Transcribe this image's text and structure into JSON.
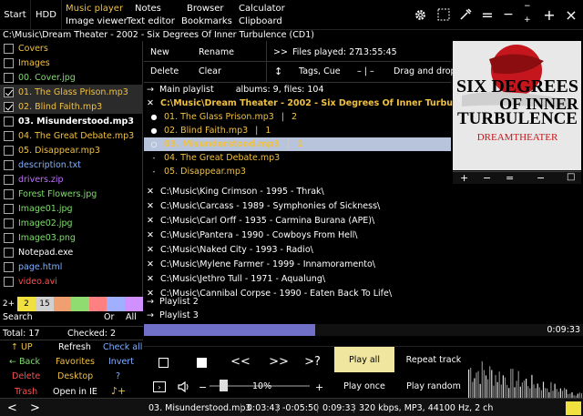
{
  "top": {
    "start": "Start",
    "hdd": "HDD",
    "menu_row1": [
      "Music player",
      "Notes",
      "Browser",
      "Calculator"
    ],
    "menu_row2": [
      "Image viewer",
      "Text editor",
      "Bookmarks",
      "Clipboard"
    ],
    "icons": [
      "gear-icon",
      "select-icon",
      "eyedropper-icon",
      "menu-icon",
      "minimize-icon",
      "maximize-icon",
      "close-icon"
    ],
    "win_plus": "+",
    "win_close": "×",
    "win_eq": "=",
    "win_min": "−",
    "win_dash_small": "−",
    "win_plus_small": "+"
  },
  "path": "C:\\Music\\Dream Theater - 2002 - Six Degrees Of Inner Turbulence (CD1)",
  "files": [
    {
      "name": "Covers",
      "color": "#f0c040",
      "checked": false,
      "bold": false,
      "sel": false
    },
    {
      "name": "Images",
      "color": "#f0c040",
      "checked": false,
      "bold": false,
      "sel": false
    },
    {
      "name": "00. Cover.jpg",
      "color": "#7fdc6c",
      "checked": false,
      "bold": false,
      "sel": false
    },
    {
      "name": "01. The Glass Prison.mp3",
      "color": "#f0c040",
      "checked": true,
      "bold": false,
      "sel": true
    },
    {
      "name": "02. Blind Faith.mp3",
      "color": "#f0c040",
      "checked": true,
      "bold": false,
      "sel": true
    },
    {
      "name": "03. Misunderstood.mp3",
      "color": "#ffffff",
      "checked": false,
      "bold": true,
      "sel": false
    },
    {
      "name": "04. The Great Debate.mp3",
      "color": "#f0c040",
      "checked": false,
      "bold": false,
      "sel": false
    },
    {
      "name": "05. Disappear.mp3",
      "color": "#f0c040",
      "checked": false,
      "bold": false,
      "sel": false
    },
    {
      "name": "description.txt",
      "color": "#80b0ff",
      "checked": false,
      "bold": false,
      "sel": false
    },
    {
      "name": "drivers.zip",
      "color": "#c070ff",
      "checked": false,
      "bold": false,
      "sel": false
    },
    {
      "name": "Forest Flowers.jpg",
      "color": "#7fdc6c",
      "checked": false,
      "bold": false,
      "sel": false
    },
    {
      "name": "Image01.jpg",
      "color": "#7fdc6c",
      "checked": false,
      "bold": false,
      "sel": false
    },
    {
      "name": "Image02.jpg",
      "color": "#7fdc6c",
      "checked": false,
      "bold": false,
      "sel": false
    },
    {
      "name": "Image03.png",
      "color": "#7fdc6c",
      "checked": false,
      "bold": false,
      "sel": false
    },
    {
      "name": "Notepad.exe",
      "color": "#ffffff",
      "checked": false,
      "bold": false,
      "sel": false
    },
    {
      "name": "page.html",
      "color": "#80b0ff",
      "checked": false,
      "bold": false,
      "sel": false
    },
    {
      "name": "video.avi",
      "color": "#ff5050",
      "checked": false,
      "bold": false,
      "sel": false
    }
  ],
  "filter": {
    "chips": [
      {
        "label": "2+",
        "color": "#000000",
        "text": "#ffffff"
      },
      {
        "label": "2",
        "color": "#f0e040",
        "text": "#000000"
      },
      {
        "label": "15",
        "color": "#d0d0d0",
        "text": "#000000"
      },
      {
        "label": "",
        "color": "#f0a070"
      },
      {
        "label": "",
        "color": "#90dc70"
      },
      {
        "label": "",
        "color": "#ff8080"
      },
      {
        "label": "",
        "color": "#a0b0ff"
      },
      {
        "label": "",
        "color": "#d090ff"
      }
    ],
    "search": "Search",
    "or": "Or",
    "all": "All"
  },
  "totals": {
    "total": "Total: 17",
    "checked": "Checked: 2"
  },
  "left_buttons": {
    "up": "↑ UP",
    "refresh": "Refresh",
    "check_all": "Check all",
    "back": "← Back",
    "favorites": "Favorites",
    "invert": "Invert",
    "delete": "Delete",
    "desktop": "Desktop",
    "help": "?",
    "trash": "Trash",
    "open_ie": "Open in IE",
    "note_plus": "♪+"
  },
  "toolbar": {
    "new": "New",
    "rename": "Rename",
    "forward": ">>",
    "files_played": "Files played: 27",
    "time": "13:55:45",
    "delete": "Delete",
    "clear": "Clear",
    "sort": "↕",
    "tags": "Tags, Cue",
    "dash": "– | –",
    "drag": "Drag and drop"
  },
  "art": {
    "line1": "SIX DEGREES",
    "line2": "OF INNER",
    "line3": "TURBULENCE",
    "line4": "DREAMTHEATER",
    "bar": [
      "+",
      "−",
      "=",
      "−",
      "□"
    ]
  },
  "playlist": {
    "main": "Main playlist",
    "main_stats": "albums: 9,  files: 104",
    "album_open": "C:\\Music\\Dream Theater - 2002 - Six Degrees Of Inner Turbulence (CD1)",
    "tracks": [
      {
        "name": "01. The Glass Prison.mp3",
        "extra": "2",
        "mark": "●",
        "color": "#f0c040"
      },
      {
        "name": "02. Blind Faith.mp3",
        "extra": "1",
        "mark": "●",
        "color": "#f0c040"
      },
      {
        "name": "03. Misunderstood.mp3",
        "extra": "1",
        "mark": "○",
        "color": "#f0c040"
      },
      {
        "name": "04. The Great Debate.mp3",
        "extra": "",
        "mark": "-",
        "color": "#f0c040"
      },
      {
        "name": "05. Disappear.mp3",
        "extra": "",
        "mark": "-",
        "color": "#f0c040"
      }
    ],
    "albums": [
      "C:\\Music\\King Crimson - 1995 - Thrak\\",
      "C:\\Music\\Carcass - 1989 - Symphonies of Sickness\\",
      "C:\\Music\\Carl Orff - 1935 - Carmina Burana (APE)\\",
      "C:\\Music\\Pantera - 1990 - Cowboys From Hell\\",
      "C:\\Music\\Naked City - 1993 - Radio\\",
      "C:\\Music\\Mylene Farmer - 1999 - Innamoramento\\",
      "C:\\Music\\Jethro Tull - 1971 - Aqualung\\",
      "C:\\Music\\Cannibal Corpse - 1990 - Eaten Back To Life\\"
    ],
    "playlist2": "Playlist 2",
    "playlist3": "Playlist 3"
  },
  "progress": {
    "fraction": 0.39,
    "time": "0:09:33"
  },
  "controls": {
    "stop": "□",
    "square": "■",
    "prev": "<<",
    "next": ">>",
    "rand": ">?",
    "play_all": "Play all",
    "repeat": "Repeat track",
    "play_once": "Play once",
    "play_random": "Play random",
    "vol_minus": "−",
    "vol_plus": "+",
    "volume": "10%",
    "volume_level": 0.1
  },
  "status": {
    "left": "<",
    "right": ">",
    "track": "03. Misunderstood.mp3",
    "t1": "0:03:43",
    "t2": "-0:05:50",
    "t3": "0:09:33",
    "info": "320 kbps, MP3, 44100 Hz, 2 ch"
  }
}
